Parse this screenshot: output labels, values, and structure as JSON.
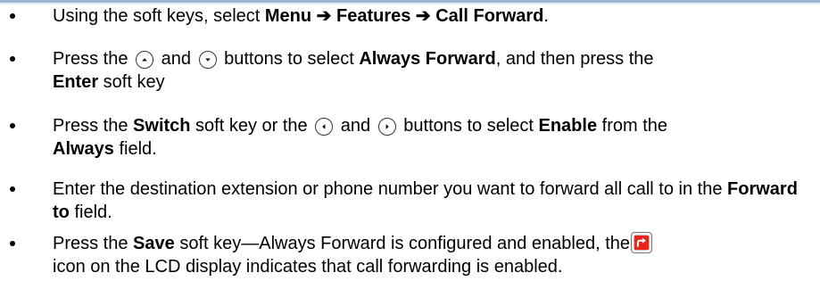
{
  "steps": [
    {
      "parts": {
        "t1": "Using the soft keys, select ",
        "b1": "Menu",
        "a1": " ➔ ",
        "b2": "Features",
        "a2": " ➔ ",
        "b3": "Call Forward",
        "t2": "."
      }
    },
    {
      "parts": {
        "t1": "Press the",
        "t2": "and",
        "t3": "buttons to select ",
        "b1": "Always Forward",
        "t4": ", and then press the ",
        "b2": "Enter",
        "t5": " soft key"
      }
    },
    {
      "parts": {
        "t1": "Press the ",
        "b1": "Switch",
        "t2": " soft key or the",
        "t3": "and",
        "t4": "buttons to select ",
        "b2": "Enable",
        "t5": " from the ",
        "b3": "Always",
        "t6": " field."
      }
    },
    {
      "parts": {
        "t1": "Enter the destination extension or phone number you want to forward all call to in the ",
        "b1": "Forward to",
        "t2": " field."
      }
    },
    {
      "parts": {
        "t1": "Press the ",
        "b1": "Save",
        "t2": " soft key—Always Forward is configured and enabled, the",
        "t3": "icon on the LCD display indicates that call forwarding is enabled."
      }
    }
  ],
  "colors": {
    "header_rule": "#9cb7d6",
    "forward_icon": "#e8261c"
  },
  "icons": [
    "up-button-icon",
    "down-button-icon",
    "left-button-icon",
    "right-button-icon",
    "call-forward-icon"
  ]
}
